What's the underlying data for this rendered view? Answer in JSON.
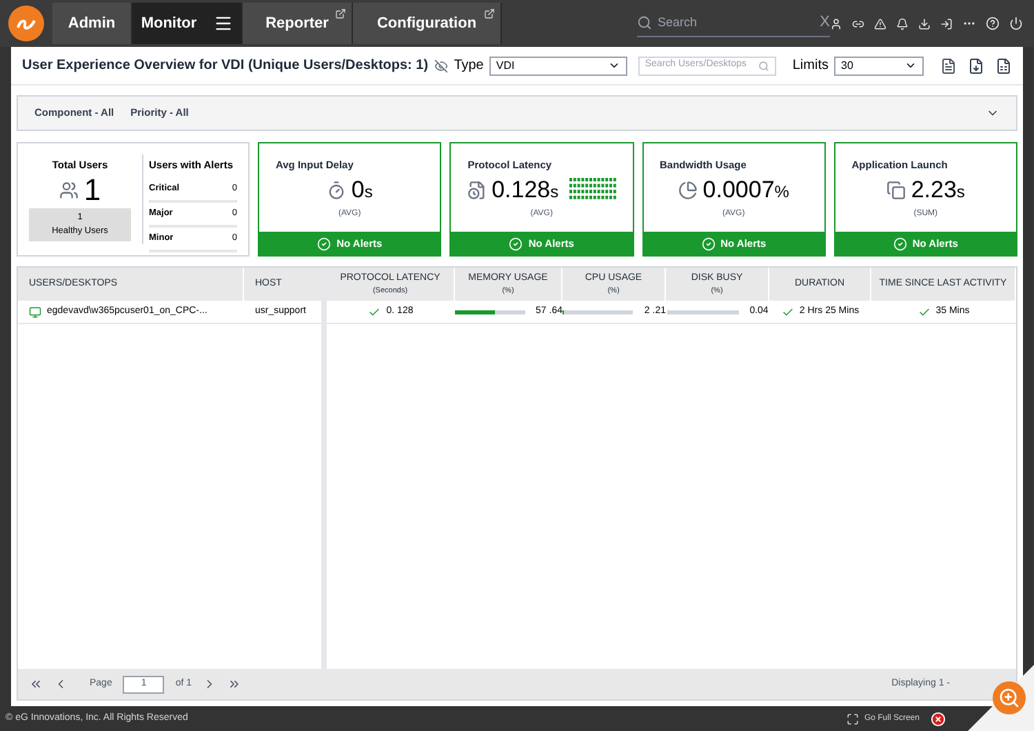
{
  "nav": {
    "tabs": [
      {
        "label": "Admin",
        "selected": false,
        "kind": "plain"
      },
      {
        "label": "Monitor",
        "selected": true,
        "kind": "menu"
      },
      {
        "label": "Reporter",
        "selected": false,
        "kind": "external"
      },
      {
        "label": "Configuration",
        "selected": false,
        "kind": "external"
      }
    ],
    "search": {
      "placeholder": "Search",
      "clear": "X"
    }
  },
  "header": {
    "title": "User Experience Overview for VDI (Unique Users/Desktops: 1)",
    "type_label": "Type",
    "type_value": "VDI",
    "search_placeholder": "Search Users/Desktops",
    "limits_label": "Limits",
    "limits_value": "30"
  },
  "filters": [
    "Component - All",
    "Priority - All"
  ],
  "summary": {
    "total_label": "Total Users",
    "total": "1",
    "healthy_count": "1",
    "healthy_label": "Healthy Users",
    "alerts_label": "Users with Alerts",
    "alerts": [
      {
        "label": "Critical",
        "count": "0"
      },
      {
        "label": "Major",
        "count": "0"
      },
      {
        "label": "Minor",
        "count": "0"
      }
    ]
  },
  "metrics": [
    {
      "title": "Avg Input Delay",
      "value": "0",
      "unit": "s",
      "aggregate": "(AVG)",
      "status": "No Alerts",
      "sparkline": false
    },
    {
      "title": "Protocol Latency",
      "value": "0.128",
      "unit": "s",
      "aggregate": "(AVG)",
      "status": "No Alerts",
      "sparkline": true
    },
    {
      "title": "Bandwidth Usage",
      "value": "0.0007",
      "unit": "%",
      "aggregate": "(AVG)",
      "status": "No Alerts",
      "sparkline": false
    },
    {
      "title": "Application Launch",
      "value": "2.23",
      "unit": "s",
      "aggregate": "(SUM)",
      "status": "No Alerts",
      "sparkline": false
    }
  ],
  "table": {
    "columns": [
      {
        "label": "USERS/DESKTOPS"
      },
      {
        "label": "HOST"
      },
      {
        "label": "PROTOCOL LATENCY",
        "sub": "(Seconds)"
      },
      {
        "label": "MEMORY USAGE",
        "sub": "(%)"
      },
      {
        "label": "CPU USAGE",
        "sub": "(%)"
      },
      {
        "label": "DISK BUSY",
        "sub": "(%)"
      },
      {
        "label": "DURATION"
      },
      {
        "label": "TIME SINCE LAST ACTIVITY"
      }
    ],
    "rows": [
      {
        "cells": [
          {
            "kind": "user",
            "text": "egdevavd\\w365pcuser01_on_CPC-..."
          },
          {
            "kind": "text",
            "text": "usr_support"
          },
          {
            "kind": "check",
            "text": "0. 128"
          },
          {
            "kind": "bar",
            "level": 0.58,
            "text": "57 .64"
          },
          {
            "kind": "bar",
            "level": 0.02,
            "text": "2 .21"
          },
          {
            "kind": "bar",
            "level": 0.0,
            "text": "0.04"
          },
          {
            "kind": "check",
            "text": "2 Hrs 25 Mins"
          },
          {
            "kind": "check",
            "text": "35 Mins"
          }
        ]
      }
    ]
  },
  "pager": {
    "page_label": "Page",
    "page": "1",
    "of": "of 1",
    "displaying": "Displaying 1 -"
  },
  "footer": {
    "copyright": "© eG Innovations, Inc. All Rights Reserved",
    "fullscreen": "Go Full Screen"
  }
}
